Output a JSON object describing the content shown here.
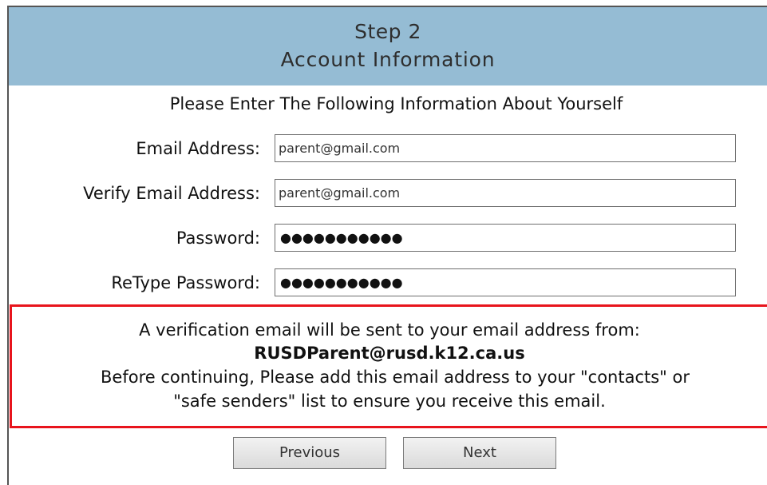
{
  "header": {
    "step": "Step 2",
    "title": "Account Information"
  },
  "form": {
    "instruction": "Please Enter The Following Information About Yourself",
    "email": {
      "label": "Email Address:",
      "value": "parent@gmail.com"
    },
    "verify_email": {
      "label": "Verify Email Address:",
      "value": "parent@gmail.com"
    },
    "password": {
      "label": "Password:",
      "value": "●●●●●●●●●●●"
    },
    "retype_password": {
      "label": "ReType Password:",
      "value": "●●●●●●●●●●●"
    }
  },
  "notice": {
    "line1": "A verification email will be sent to your email address from:",
    "sender": "RUSDParent@rusd.k12.ca.us",
    "line3": "Before continuing, Please add this email address to your \"contacts\" or",
    "line4": "\"safe senders\" list to ensure you receive this email.",
    "border_color": "#e8141c"
  },
  "buttons": {
    "previous": "Previous",
    "next": "Next"
  },
  "colors": {
    "header_bg": "#95bcd4"
  }
}
